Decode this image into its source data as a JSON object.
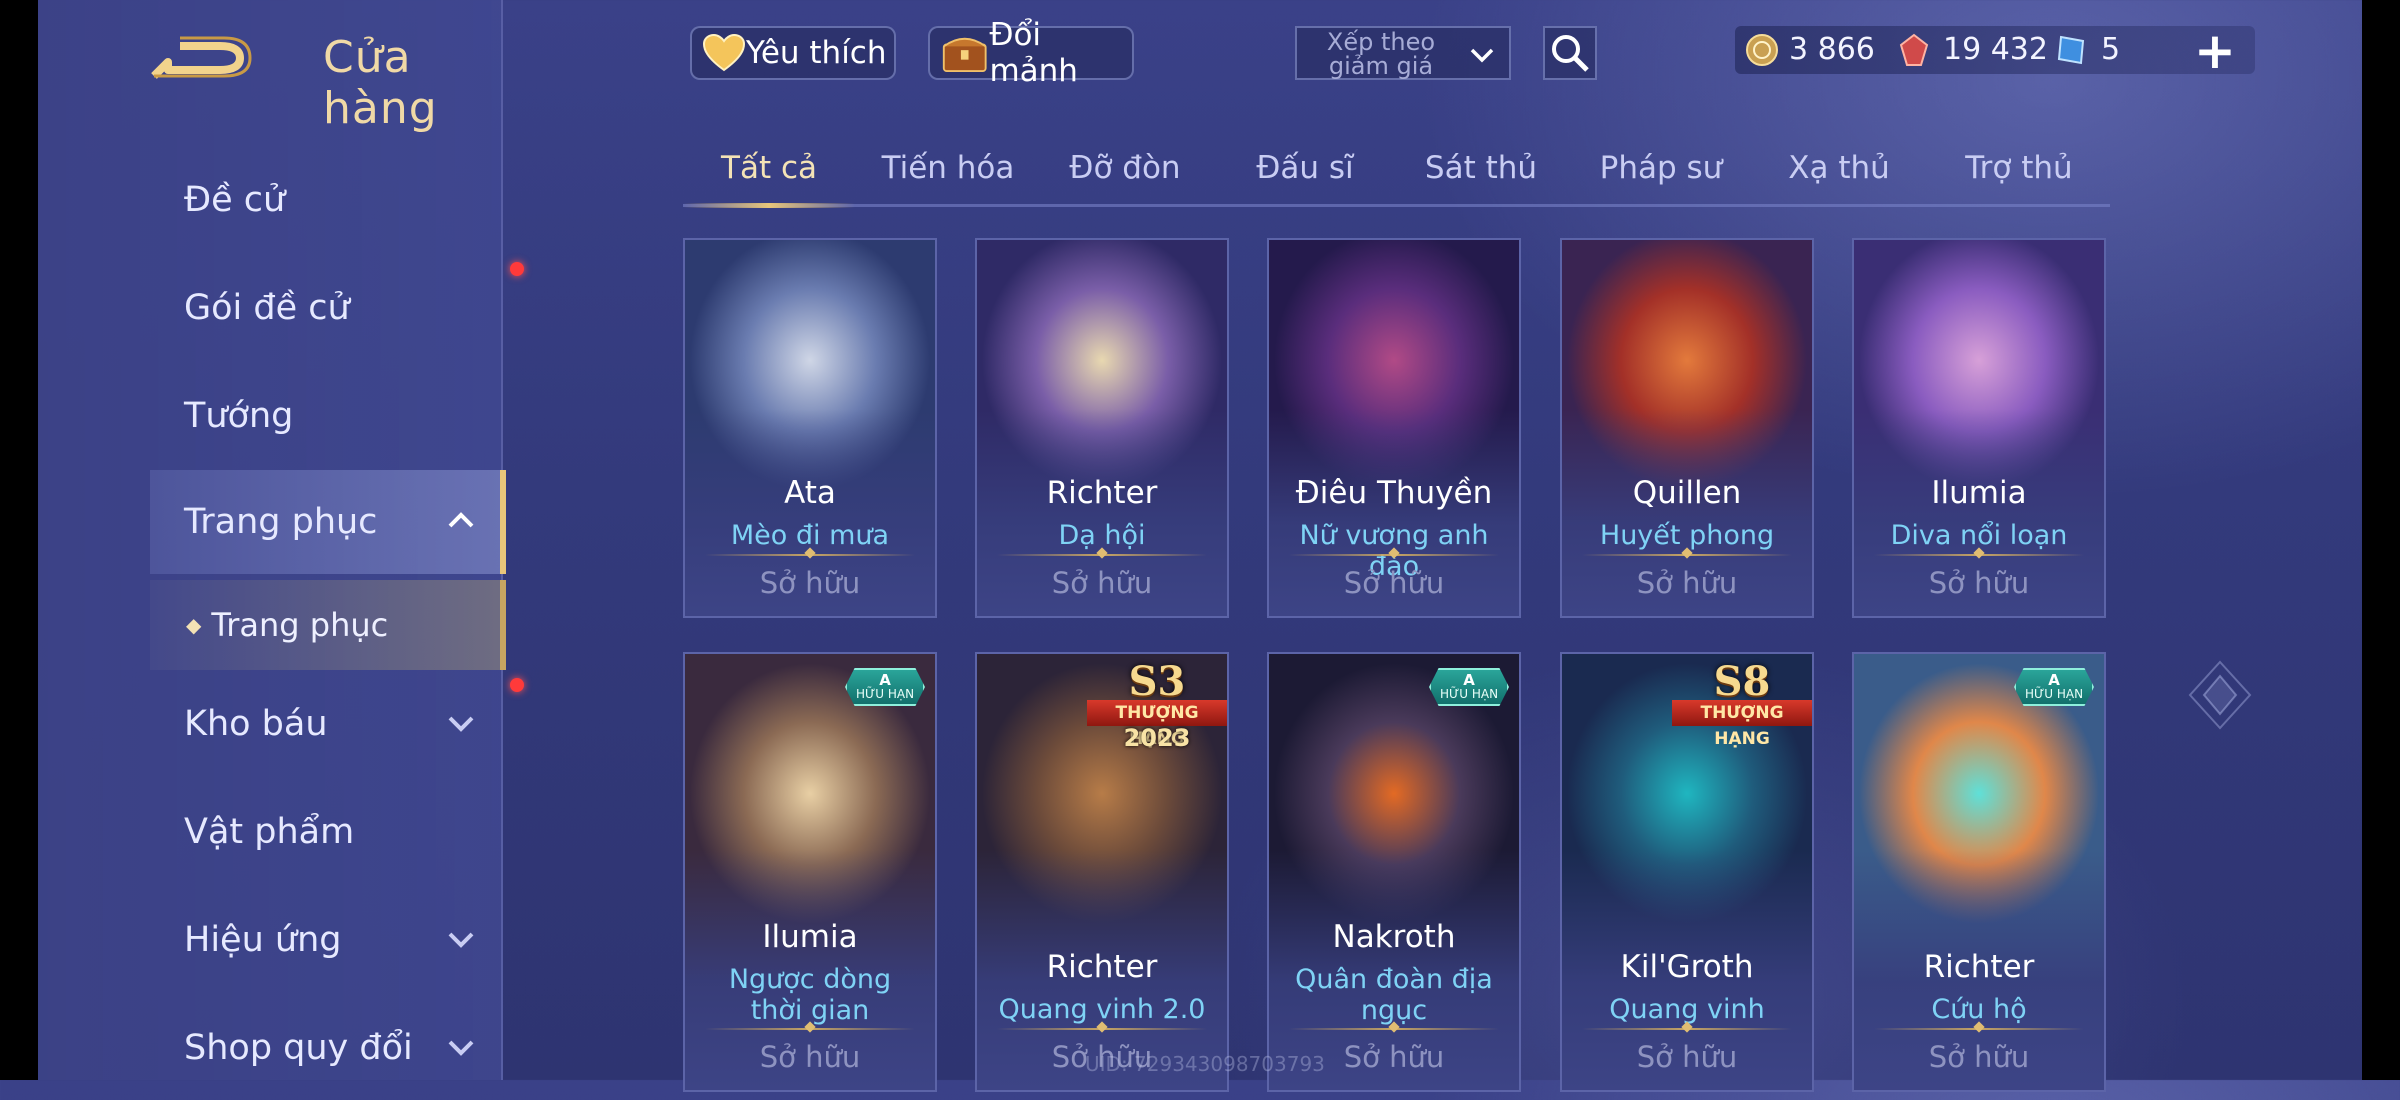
{
  "header": {
    "title": "Cửa hàng",
    "favorite_label": "Yêu thích",
    "fragment_label": "Đổi mảnh",
    "sort_label": "Xếp theo giảm giá",
    "currencies": [
      {
        "icon": "gold-coin-icon",
        "value": "3 866"
      },
      {
        "icon": "red-gem-icon",
        "value": "19 432"
      },
      {
        "icon": "blue-voucher-icon",
        "value": "5"
      }
    ]
  },
  "sidebar": {
    "items": [
      {
        "label": "Đề cử",
        "badge": false
      },
      {
        "label": "Gói đề cử",
        "badge": true
      },
      {
        "label": "Tướng",
        "badge": false
      },
      {
        "label": "Trang phục",
        "badge": false,
        "expanded": true
      },
      {
        "label": "Kho báu",
        "badge": true
      },
      {
        "label": "Vật phẩm",
        "badge": false
      },
      {
        "label": "Hiệu ứng",
        "badge": false
      },
      {
        "label": "Shop quy đổi",
        "badge": false
      }
    ],
    "sub_item": "Trang phục"
  },
  "tabs": [
    "Tất cả",
    "Tiến hóa",
    "Đỡ đòn",
    "Đấu sĩ",
    "Sát thủ",
    "Pháp sư",
    "Xạ thủ",
    "Trợ thủ"
  ],
  "active_tab": "Tất cả",
  "cards": [
    {
      "hero": "Ata",
      "skin": "Mèo đi mưa",
      "status": "Sở hữu",
      "art": [
        "#cfd6e6",
        "#6a7cb0",
        "#2d3b70"
      ]
    },
    {
      "hero": "Richter",
      "skin": "Dạ hội",
      "status": "Sở hữu",
      "art": [
        "#e8d8b0",
        "#7a5ea8",
        "#2f2a66"
      ]
    },
    {
      "hero": "Điêu Thuyền",
      "skin": "Nữ vương anh đào",
      "status": "Sở hữu",
      "art": [
        "#b14a86",
        "#5a2d7c",
        "#241a4c"
      ]
    },
    {
      "hero": "Quillen",
      "skin": "Huyết phong",
      "status": "Sở hữu",
      "art": [
        "#e37a3c",
        "#a33028",
        "#3a2452"
      ]
    },
    {
      "hero": "Ilumia",
      "skin": "Diva nổi loạn",
      "status": "Sở hữu",
      "art": [
        "#d7a0d8",
        "#8a5cc0",
        "#3a2e74"
      ]
    },
    {
      "hero": "Ilumia",
      "skin": "Ngược dòng thời gian",
      "status": "Sở hữu",
      "badge": {
        "type": "limited",
        "letter": "A",
        "text": "HỮU HẠN"
      },
      "art": [
        "#e8cfa4",
        "#8b6a54",
        "#3a2a3e"
      ]
    },
    {
      "hero": "Richter",
      "skin": "Quang vinh 2.0",
      "status": "Sở hữu",
      "badge": {
        "type": "rank",
        "season": "S3",
        "text": "THƯỢNG HẠNG",
        "year": "2023"
      },
      "art": [
        "#b77c48",
        "#6b4a3a",
        "#2c2438"
      ]
    },
    {
      "hero": "Nakroth",
      "skin": "Quân đoàn địa ngục",
      "status": "Sở hữu",
      "badge": {
        "type": "limited",
        "letter": "A",
        "text": "HỮU HẠN"
      },
      "art": [
        "#e36a24",
        "#4a3a5a",
        "#1c1a34"
      ]
    },
    {
      "hero": "Kil'Groth",
      "skin": "Quang vinh",
      "status": "Sở hữu",
      "badge": {
        "type": "rank",
        "season": "S8",
        "text": "THƯỢNG HẠNG",
        "year": ""
      },
      "art": [
        "#1fb6c0",
        "#1f5c7c",
        "#1a2a50"
      ]
    },
    {
      "hero": "Richter",
      "skin": "Cứu hộ",
      "status": "Sở hữu",
      "badge": {
        "type": "limited",
        "letter": "A",
        "text": "HỮU HẠN"
      },
      "art": [
        "#5fe0d8",
        "#e0874a",
        "#3a5c8a"
      ]
    }
  ],
  "uid_text": "UID: 729343098703793"
}
